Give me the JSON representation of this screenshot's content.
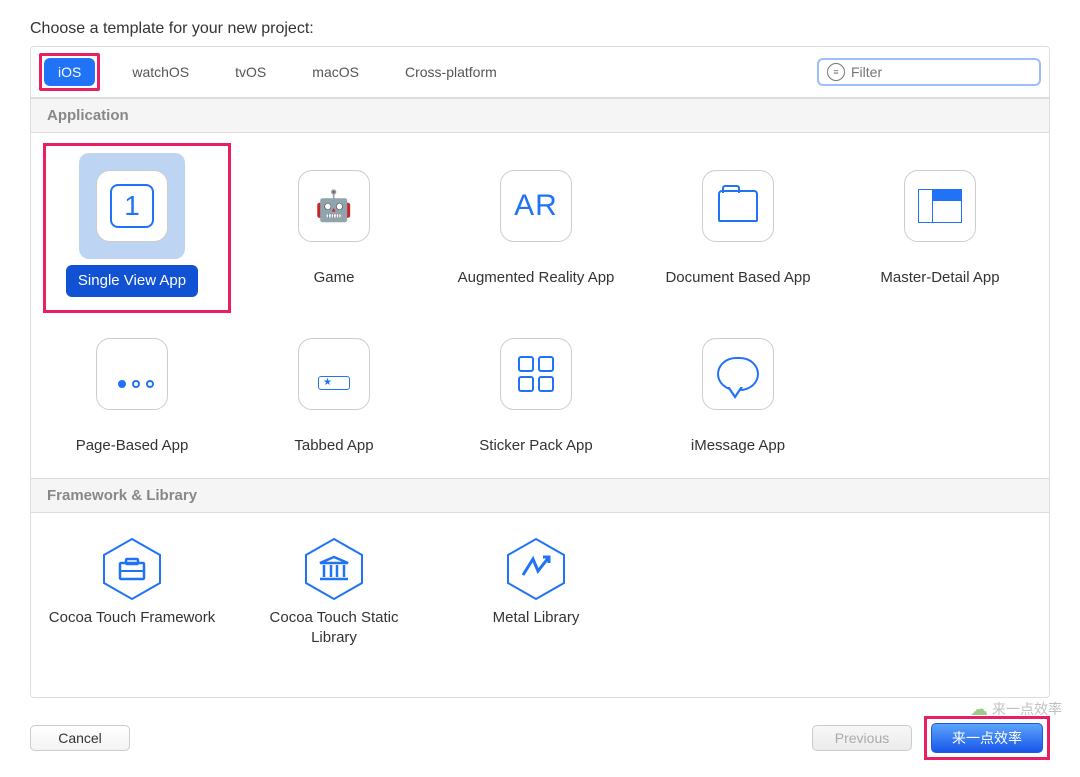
{
  "dialog": {
    "title": "Choose a template for your new project:"
  },
  "tabs": {
    "ios": "iOS",
    "watchos": "watchOS",
    "tvos": "tvOS",
    "macos": "macOS",
    "crossplatform": "Cross-platform",
    "active": "ios"
  },
  "filter": {
    "placeholder": "Filter"
  },
  "sections": {
    "application": "Application",
    "framework": "Framework & Library"
  },
  "templates": {
    "application": [
      {
        "id": "single-view-app",
        "label": "Single View App",
        "selected": true,
        "glyph": "1"
      },
      {
        "id": "game",
        "label": "Game",
        "selected": false,
        "glyph": "game"
      },
      {
        "id": "ar-app",
        "label": "Augmented Reality App",
        "selected": false,
        "glyph": "AR"
      },
      {
        "id": "doc-app",
        "label": "Document Based App",
        "selected": false,
        "glyph": "doc"
      },
      {
        "id": "md-app",
        "label": "Master-Detail App",
        "selected": false,
        "glyph": "md"
      },
      {
        "id": "page-app",
        "label": "Page-Based App",
        "selected": false,
        "glyph": "page"
      },
      {
        "id": "tabbed-app",
        "label": "Tabbed App",
        "selected": false,
        "glyph": "tab"
      },
      {
        "id": "sticker-app",
        "label": "Sticker Pack App",
        "selected": false,
        "glyph": "sticker"
      },
      {
        "id": "imessage-app",
        "label": "iMessage App",
        "selected": false,
        "glyph": "msg"
      }
    ],
    "framework": [
      {
        "id": "cocoa-fw",
        "label": "Cocoa Touch Framework",
        "glyph": "briefcase"
      },
      {
        "id": "cocoa-sl",
        "label": "Cocoa Touch Static Library",
        "glyph": "columns"
      },
      {
        "id": "metal-lib",
        "label": "Metal Library",
        "glyph": "lightning"
      }
    ]
  },
  "buttons": {
    "cancel": "Cancel",
    "previous": "Previous",
    "next": "来一点效率"
  },
  "watermark": "来一点效率"
}
